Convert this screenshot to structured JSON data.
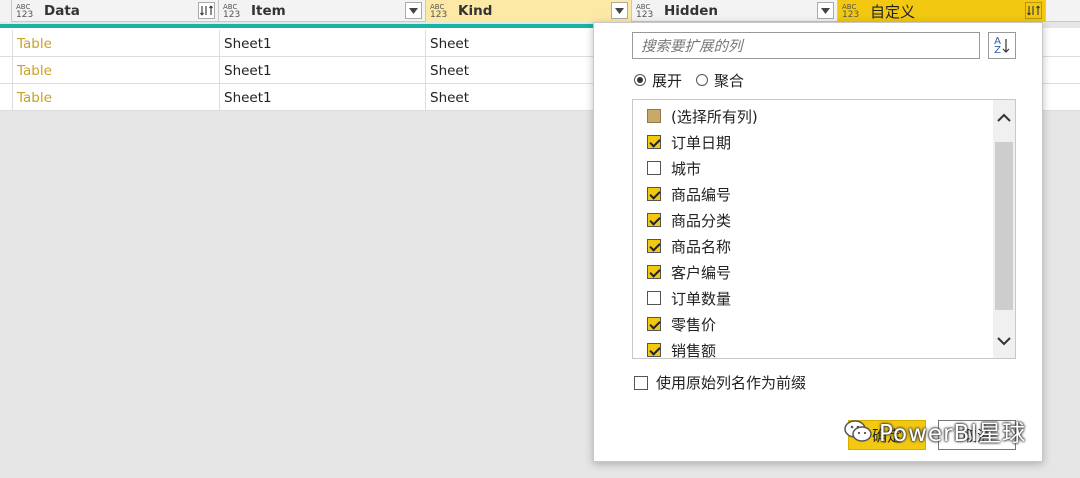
{
  "columns": [
    {
      "type_top": "ABC",
      "type_bottom": "123",
      "name": "Data"
    },
    {
      "type_top": "ABC",
      "type_bottom": "123",
      "name": "Item"
    },
    {
      "type_top": "ABC",
      "type_bottom": "123",
      "name": "Kind"
    },
    {
      "type_top": "ABC",
      "type_bottom": "123",
      "name": "Hidden"
    },
    {
      "type_top": "ABC",
      "type_bottom": "123",
      "name": "自定义"
    }
  ],
  "rows": [
    {
      "data": "Table",
      "item": "Sheet1",
      "kind": "Sheet"
    },
    {
      "data": "Table",
      "item": "Sheet1",
      "kind": "Sheet"
    },
    {
      "data": "Table",
      "item": "Sheet1",
      "kind": "Sheet"
    }
  ],
  "popup": {
    "search_placeholder": "搜索要扩展的列",
    "sort_icon": "az-sort-icon",
    "sort_top": "A",
    "sort_bottom": "Z",
    "radio_expand": "展开",
    "radio_aggregate": "聚合",
    "radio_selected": "expand",
    "select_all": "(选择所有列)",
    "items": [
      {
        "label": "订单日期",
        "checked": true
      },
      {
        "label": "城市",
        "checked": false
      },
      {
        "label": "商品编号",
        "checked": true
      },
      {
        "label": "商品分类",
        "checked": true
      },
      {
        "label": "商品名称",
        "checked": true
      },
      {
        "label": "客户编号",
        "checked": true
      },
      {
        "label": "订单数量",
        "checked": false
      },
      {
        "label": "零售价",
        "checked": true
      },
      {
        "label": "销售额",
        "checked": true
      }
    ],
    "prefix_label": "使用原始列名作为前缀",
    "prefix_checked": false,
    "ok_label": "确定",
    "cancel_label": "取消"
  },
  "watermark": {
    "text": "PowerBI星球",
    "icon": "wechat-icon"
  },
  "colors": {
    "accent": "#f2c811",
    "teal": "#17b3a3",
    "link": "#c9a226"
  }
}
